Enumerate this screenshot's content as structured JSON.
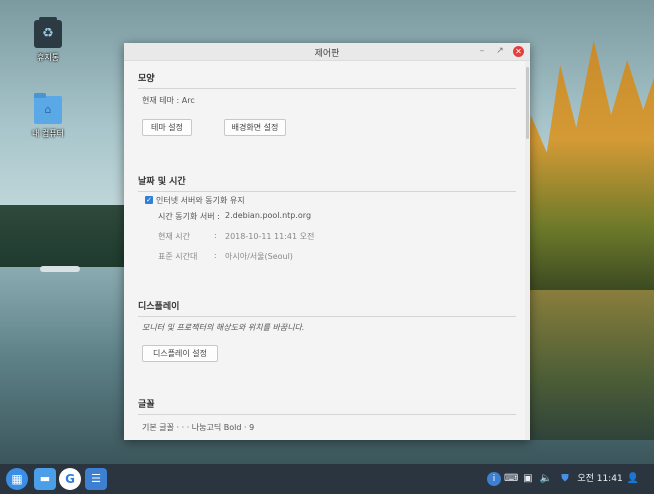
{
  "desktop": {
    "icons": [
      {
        "label": "휴지통",
        "icon": "trash-icon"
      },
      {
        "label": "내 컴퓨터",
        "icon": "folder-icon"
      }
    ]
  },
  "window": {
    "title": "제어판",
    "controls": {
      "minimize": "–",
      "maximize": "↗",
      "close": "✕"
    },
    "sections": {
      "appearance": {
        "title": "모양",
        "current_theme_label": "현재 테마 :",
        "current_theme_value": "Arc",
        "theme_button": "테마 설정",
        "wallpaper_button": "배경화면 설정"
      },
      "datetime": {
        "title": "날짜 및 시간",
        "sync_checkbox_label": "인터넷 서버와 동기화 유지",
        "sync_checked": true,
        "server_label": "시간 동기화 서버 :",
        "server_value": "2.debian.pool.ntp.org",
        "current_time_label": "현재 시간",
        "current_time_value": "2018-10-11 11:41 오전",
        "timezone_label": "표준 시간대",
        "timezone_value": "아시아/서울(Seoul)",
        "colon": ":"
      },
      "display": {
        "title": "디스플레이",
        "description": "모니터 및 프로젝터의 해상도와 위치를 바꿉니다.",
        "settings_button": "디스플레이 설정"
      },
      "font": {
        "title": "글꼴",
        "partial_row": "기본 글꼴 · · · 나눔고딕 Bold · 9"
      }
    }
  },
  "taskbar": {
    "apps": [
      {
        "name": "launcher",
        "glyph": "▦"
      },
      {
        "name": "files",
        "glyph": "▬"
      },
      {
        "name": "browser",
        "glyph": "G"
      },
      {
        "name": "control-panel",
        "glyph": "☰"
      }
    ],
    "tray": {
      "info": "i",
      "keyboard": "⌨",
      "screen": "▣",
      "volume": "🔈",
      "shield": "⛊",
      "clock": "오전 11:41",
      "user": "👤"
    }
  }
}
